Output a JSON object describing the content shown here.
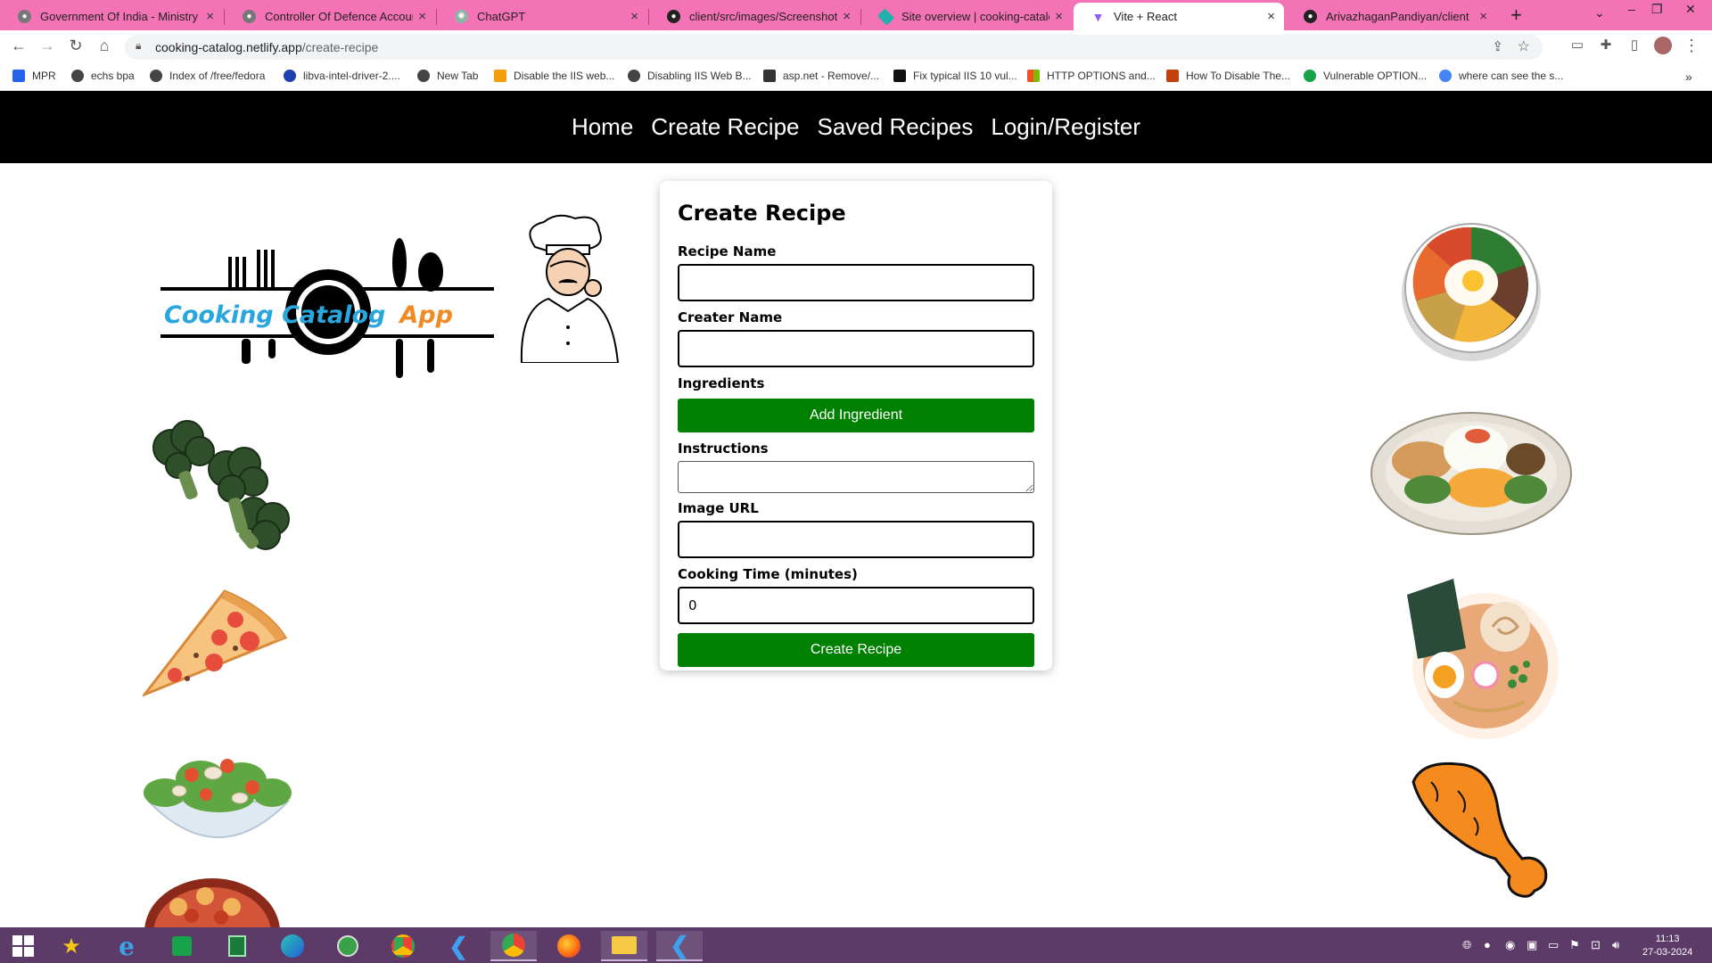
{
  "browser": {
    "tabs": [
      {
        "title": "Government Of India - Ministry o",
        "active": false
      },
      {
        "title": "Controller Of Defence Accounts",
        "active": false
      },
      {
        "title": "ChatGPT",
        "active": false
      },
      {
        "title": "client/src/images/Screenshot.pn",
        "active": false
      },
      {
        "title": "Site overview | cooking-catalog |",
        "active": false
      },
      {
        "title": "Vite + React",
        "active": true
      },
      {
        "title": "ArivazhaganPandiyan/client",
        "active": false
      }
    ],
    "url_host": "cooking-catalog.netlify.app",
    "url_path": "/create-recipe",
    "bookmarks": [
      "MPR",
      "echs bpa",
      "Index of /free/fedora",
      "libva-intel-driver-2....",
      "New Tab",
      "Disable the IIS web...",
      "Disabling IIS Web B...",
      "asp.net - Remove/...",
      "Fix typical IIS 10 vul...",
      "HTTP OPTIONS and...",
      "How To Disable The...",
      "Vulnerable OPTION...",
      "where can see the s..."
    ]
  },
  "nav": {
    "home": "Home",
    "create": "Create Recipe",
    "saved": "Saved Recipes",
    "login": "Login/Register"
  },
  "logo": {
    "part1": "Cooking Catalog",
    "part2": "App"
  },
  "form": {
    "title": "Create Recipe",
    "recipe_name_label": "Recipe Name",
    "recipe_name_value": "",
    "creator_label": "Creater Name",
    "creator_value": "",
    "ingredients_label": "Ingredients",
    "add_ingredient": "Add Ingredient",
    "instructions_label": "Instructions",
    "image_url_label": "Image URL",
    "image_url_value": "",
    "cooking_time_label": "Cooking Time (minutes)",
    "cooking_time_value": "0",
    "submit": "Create Recipe"
  },
  "taskbar": {
    "time": "11:13",
    "date": "27-03-2024",
    "apps": [
      "windows-start",
      "favorites",
      "internet-explorer",
      "store",
      "calculator",
      "edge",
      "xbox",
      "chrome",
      "vscode",
      "chrome-active",
      "firefox",
      "file-explorer",
      "vscode-active"
    ]
  },
  "colors": {
    "tab_strip": "#f472b6",
    "navbar": "#000000",
    "button_green": "#008000",
    "taskbar": "#5c3b68"
  }
}
